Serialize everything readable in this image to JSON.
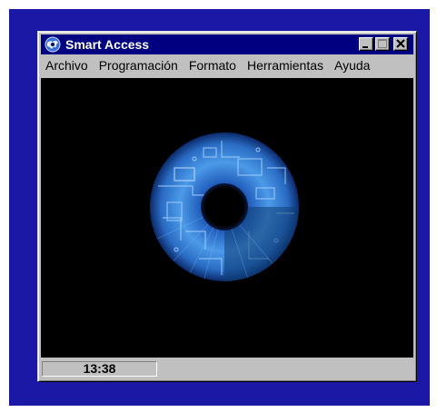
{
  "window": {
    "title": "Smart Access",
    "title_icon": "globe-app-icon",
    "buttons": {
      "minimize_icon": "minimize-icon",
      "maximize_icon": "maximize-icon",
      "close_icon": "close-icon"
    }
  },
  "menu": {
    "items": [
      {
        "label": "Archivo"
      },
      {
        "label": "Programación"
      },
      {
        "label": "Formato"
      },
      {
        "label": "Herramientas"
      },
      {
        "label": "Ayuda"
      }
    ]
  },
  "content": {
    "image": "blue-circuit-eye-iris",
    "background": "#000000"
  },
  "statusbar": {
    "time": "13:38"
  },
  "colors": {
    "desktop": "#1b18a6",
    "titlebar": "#000080",
    "window_face": "#c0c0c0"
  }
}
